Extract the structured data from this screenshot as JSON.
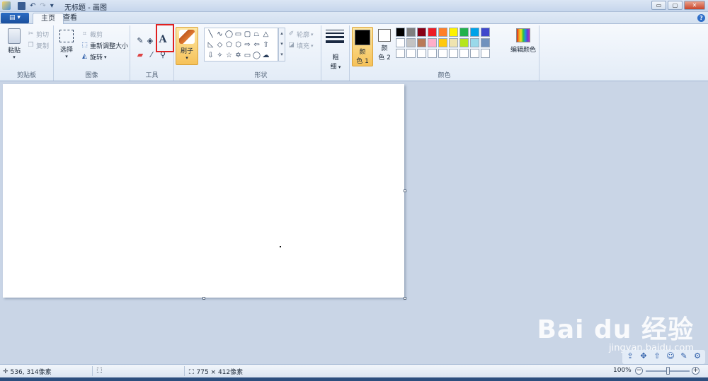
{
  "window": {
    "title": "无标题 - 画图",
    "minimize": "▭",
    "maximize": "▢",
    "close": "✕"
  },
  "quick_access": {
    "save_icon": "floppy-icon",
    "undo_icon": "undo-icon",
    "redo_icon": "redo-icon",
    "more": "▾"
  },
  "tabs": {
    "file_menu": "▤ ▾",
    "home": "主页",
    "view": "查看",
    "help": "?"
  },
  "ribbon": {
    "clipboard": {
      "paste": "粘贴",
      "cut": "剪切",
      "copy": "复制",
      "label": "剪贴板"
    },
    "image": {
      "select": "选择",
      "crop": "裁剪",
      "resize": "重新调整大小",
      "rotate": "旋转",
      "label": "图像"
    },
    "tools": {
      "label": "工具",
      "text_glyph": "A"
    },
    "brushes": {
      "label": "刷子"
    },
    "shapes": {
      "outline": "轮廓",
      "fill": "填充",
      "label": "形状"
    },
    "size": {
      "line1": "粗",
      "line2": "细"
    },
    "colors": {
      "color1_line1": "颜",
      "color1_line2": "色 1",
      "color2_line1": "颜",
      "color2_line2": "色 2",
      "edit_colors": "编辑颜色",
      "label": "颜色",
      "color1_value": "#000000",
      "color2_value": "#ffffff",
      "palette": [
        "#000000",
        "#7f7f7f",
        "#880015",
        "#ed1c24",
        "#ff7f27",
        "#fff200",
        "#22b14c",
        "#00a2e8",
        "#3f48cc",
        "#a349a4",
        "#ffffff",
        "#c3c3c3",
        "#b97a57",
        "#ffaec9",
        "#ffc90e",
        "#efe4b0",
        "#b5e61d",
        "#99d9ea",
        "#7092be",
        "#c8bfe7"
      ]
    }
  },
  "status": {
    "cursor_pos": "536, 314像素",
    "image_size": "775 × 412像素",
    "zoom": "100%",
    "zoom_out": "−",
    "zoom_in": "+"
  },
  "watermark": {
    "brand": "Bai du 经验",
    "url": "jingyan.baidu.com"
  }
}
